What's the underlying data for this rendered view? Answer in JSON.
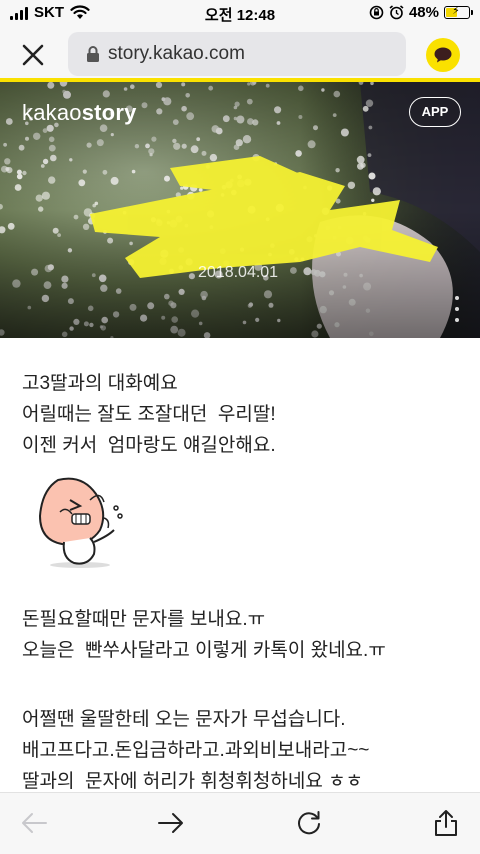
{
  "status_bar": {
    "carrier": "SKT",
    "time": "오전 12:48",
    "battery_percent": "48%",
    "battery_level": 0.48,
    "icons": [
      "signal-bars-icon",
      "wifi-icon",
      "orientation-lock-icon",
      "alarm-icon",
      "battery-icon"
    ]
  },
  "browser": {
    "url": "story.kakao.com",
    "icons": [
      "close-icon",
      "lock-icon",
      "kakaotalk-chat-icon"
    ]
  },
  "cover": {
    "logo_regular": "kakao",
    "logo_bold": "story",
    "app_button": "APP",
    "date": "2018.04.01",
    "icons": [
      "more-vertical-icon"
    ]
  },
  "post": {
    "paragraphs": [
      [
        "고3딸과의 대화예요",
        "어릴때는 잘도 조잘대던  우리딸!",
        "이젠 커서  엄마랑도 얘길안해요."
      ],
      [
        "돈필요할때만 문자를 보내요.ㅠ",
        "오늘은  빤쑤사달라고 이렇게 카톡이 왔네요.ㅠ"
      ],
      [
        "어쩔땐 울딸한테 오는 문자가 무섭습니다.",
        "배고프다고.돈입금하라고.과외비보내라고~~",
        "딸과의  문자에 허리가 휘청휘청하네요 ㅎㅎ"
      ]
    ],
    "sticker": "apeach-sticker"
  },
  "bottom_toolbar": {
    "icons": [
      "back-arrow-icon",
      "forward-arrow-icon",
      "reload-icon",
      "share-icon"
    ]
  },
  "colors": {
    "accent": "#fae100",
    "toolbar_bg": "#f7f7f7",
    "url_bg": "#e6e6e9",
    "text": "#222222"
  }
}
